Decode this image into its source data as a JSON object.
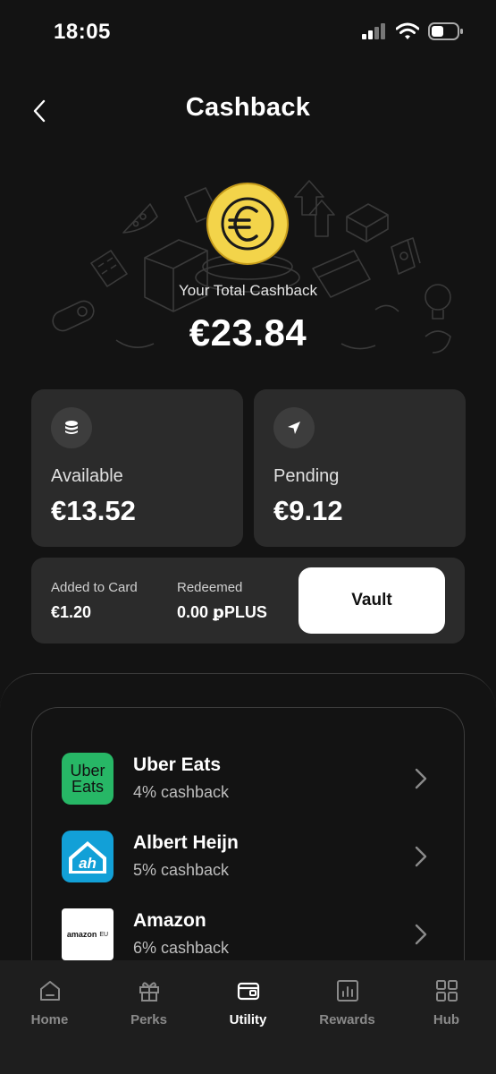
{
  "status_bar": {
    "time": "18:05"
  },
  "header": {
    "title": "Cashback"
  },
  "hero": {
    "label": "Your Total Cashback",
    "amount": "€23.84",
    "coin_symbol": "€"
  },
  "cards": {
    "available": {
      "label": "Available",
      "value": "€13.52",
      "icon": "coins-icon"
    },
    "pending": {
      "label": "Pending",
      "value": "€9.12",
      "icon": "send-icon"
    }
  },
  "summary": {
    "added_label": "Added to Card",
    "added_value": "€1.20",
    "redeemed_label": "Redeemed",
    "redeemed_value": "0.00 ꝑPLUS",
    "vault_label": "Vault"
  },
  "partners": [
    {
      "name": "Uber Eats",
      "rate": "4% cashback",
      "logo_line1": "Uber",
      "logo_line2": "Eats",
      "logo_color": "#27b766"
    },
    {
      "name": "Albert Heijn",
      "rate": "5% cashback",
      "logo_text": "ah",
      "logo_color": "#12a0d7"
    },
    {
      "name": "Amazon",
      "rate": "6% cashback",
      "logo_text": "amazon",
      "logo_suffix": "EU",
      "logo_color": "#ffffff"
    }
  ],
  "nav": [
    {
      "label": "Home",
      "icon": "home-icon",
      "active": false
    },
    {
      "label": "Perks",
      "icon": "gift-icon",
      "active": false
    },
    {
      "label": "Utility",
      "icon": "wallet-icon",
      "active": true
    },
    {
      "label": "Rewards",
      "icon": "chart-icon",
      "active": false
    },
    {
      "label": "Hub",
      "icon": "grid-icon",
      "active": false
    }
  ],
  "colors": {
    "background": "#131313",
    "card": "#2b2b2b",
    "coin": "#f3d44a",
    "accent": "#ffffff"
  }
}
